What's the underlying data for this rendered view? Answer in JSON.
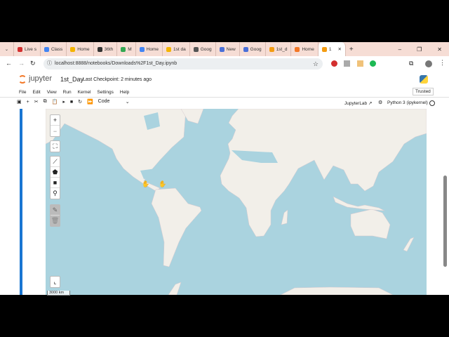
{
  "browser": {
    "tabs": [
      "Live s",
      "Class",
      "Home",
      "36th",
      "M",
      "Home",
      "1st da",
      "Goog",
      "New",
      "Goog",
      "1st_d",
      "Home",
      "1"
    ],
    "url": "localhost:8888/notebooks/Downloads%2F1st_Day.ipynb",
    "new_tab": "+",
    "window_controls": {
      "minimize": "–",
      "restore": "❐",
      "close": "✕"
    }
  },
  "jupyter": {
    "logo": "jupyter",
    "notebook_name": "1st_Day",
    "checkpoint": "Last Checkpoint: 2 minutes ago",
    "menu": [
      "File",
      "Edit",
      "View",
      "Run",
      "Kernel",
      "Settings",
      "Help"
    ],
    "trusted": "Trusted",
    "cell_type": "Code",
    "jupyterlab": "JupyterLab",
    "kernel": "Python 3 (ipykernel)"
  },
  "map": {
    "zoom_in": "+",
    "zoom_out": "−",
    "scale": "3000 km"
  }
}
